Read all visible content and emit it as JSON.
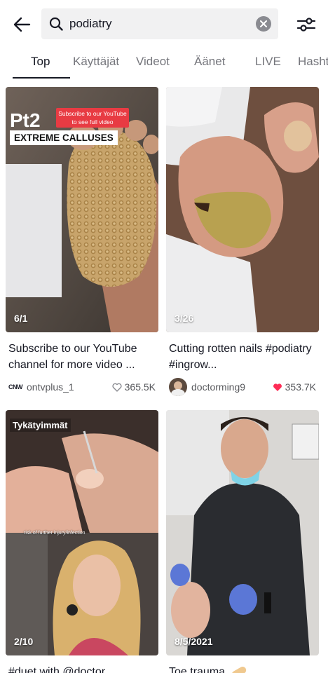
{
  "search": {
    "query": "podiatry"
  },
  "tabs": [
    "Top",
    "Käyttäjät",
    "Videot",
    "Äänet",
    "LIVE",
    "Hashtags"
  ],
  "videos": [
    {
      "counter": "6/1",
      "caption": "Subscribe to our YouTube channel for more video ...",
      "user": "ontvplus_1",
      "user_badge": "CNW",
      "likes": "365.5K",
      "liked": false,
      "overlay_title": "Pt2",
      "overlay_banner": "Subscribe to our YouTube to see full video",
      "overlay_label": "EXTREME CALLUSES"
    },
    {
      "counter": "3/26",
      "caption": "Cutting rotten nails #podiatry #ingrow...",
      "user": "doctorming9",
      "likes": "353.7K",
      "liked": true
    },
    {
      "counter": "2/10",
      "caption": "#duet with @doctor",
      "overlay_label": "Tykätyimmät",
      "overlay_note": "risk of further injury/infection"
    },
    {
      "counter": "8/5/2021",
      "caption": "Toe trauma"
    }
  ],
  "colors": {
    "liked_heart": "#fe2c55",
    "search_bg": "#f1f1f2"
  }
}
